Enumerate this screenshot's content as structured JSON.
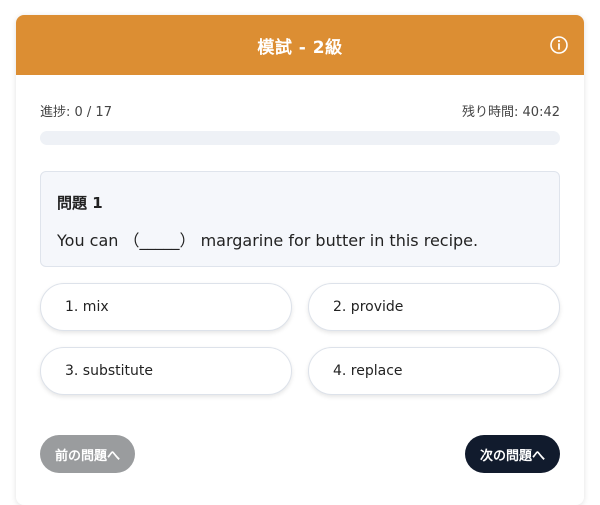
{
  "header": {
    "title": "模試 - 2級",
    "info_icon": "info-circle-icon"
  },
  "progress": {
    "label": "進捗: 0 / 17",
    "current": 0,
    "total": 17,
    "fraction": 0,
    "time_remaining": "残り時間: 40:42"
  },
  "question": {
    "title": "問題 1",
    "text": "You can （_____） margarine for butter in this recipe."
  },
  "options": [
    {
      "label": "1. mix"
    },
    {
      "label": "2. provide"
    },
    {
      "label": "3. substitute"
    },
    {
      "label": "4. replace"
    }
  ],
  "nav": {
    "prev_label": "前の問題へ",
    "next_label": "次の問題へ"
  },
  "colors": {
    "accent": "#dc8e33",
    "next_button": "#111b2d",
    "prev_button": "#9a9c9e"
  }
}
